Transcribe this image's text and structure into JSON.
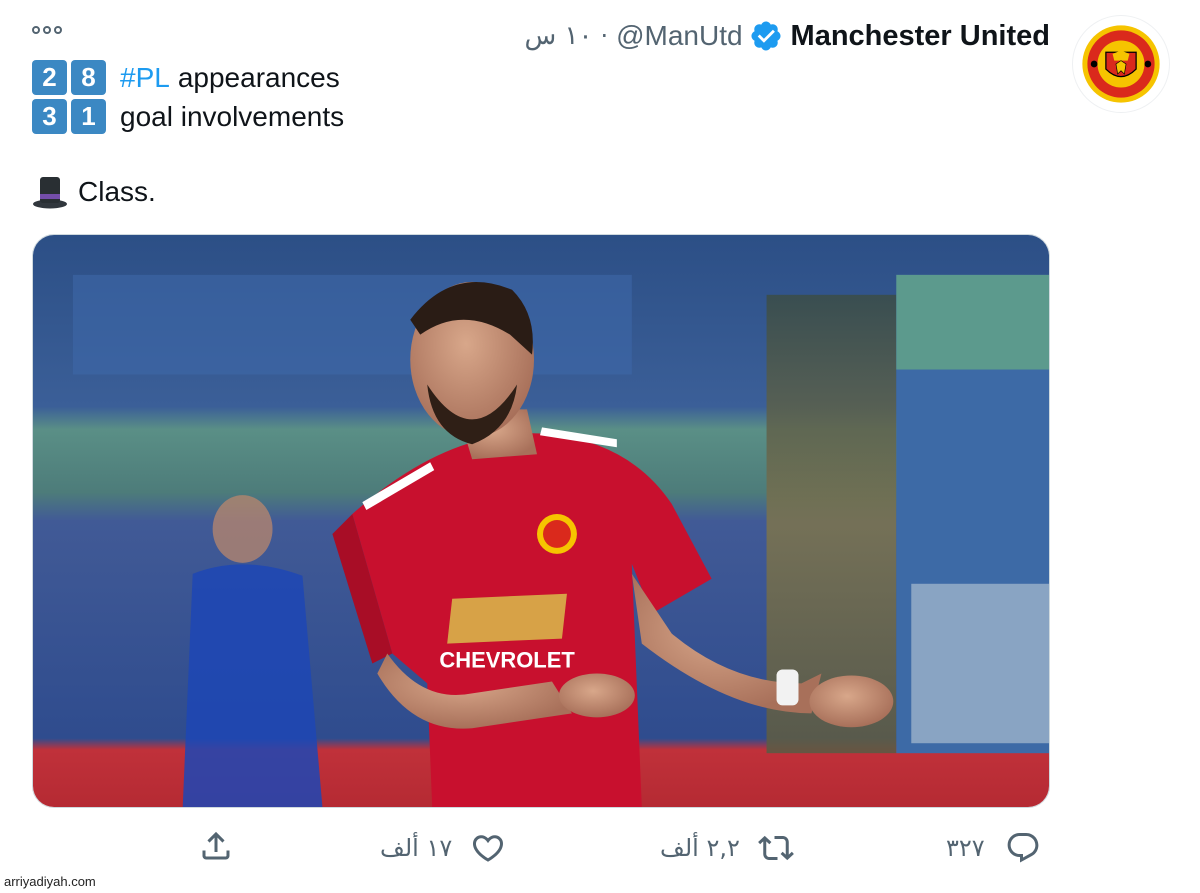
{
  "account": {
    "name": "Manchester United",
    "handle": "@ManUtd",
    "separator": "·",
    "time": "١٠ س",
    "verified": true
  },
  "tweet": {
    "stat1": {
      "digits": [
        "2",
        "8"
      ],
      "hashtag": "#PL",
      "text": "appearances"
    },
    "stat2": {
      "digits": [
        "3",
        "1"
      ],
      "text": "goal involvements"
    },
    "line3": {
      "text": "Class."
    }
  },
  "media": {
    "jersey_sponsor": "CHEVROLET"
  },
  "actions": {
    "reply_count": "٣٢٧",
    "retweet_count": "٢,٢ ألف",
    "like_count": "١٧ ألف"
  },
  "watermark": "arriyadiyah.com",
  "colors": {
    "accent": "#1d9bf0",
    "keycap": "#3b88c3",
    "muted": "#536471",
    "jersey_red": "#c8102e"
  },
  "icons": [
    "more-icon",
    "verified-icon",
    "reply-icon",
    "retweet-icon",
    "like-icon",
    "share-icon",
    "tophat-icon"
  ]
}
